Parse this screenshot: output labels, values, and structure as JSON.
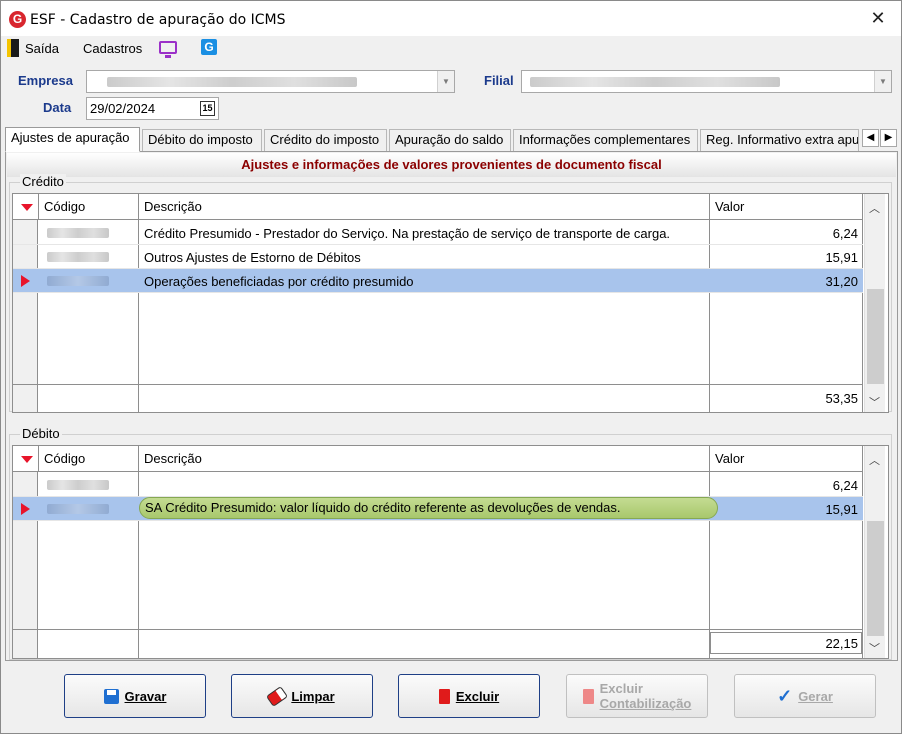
{
  "window": {
    "title": "ESF - Cadastro de apuração do ICMS",
    "app_icon_letter": "G",
    "close_glyph": "✕"
  },
  "menu": {
    "items": [
      {
        "label": "Saída",
        "icon": "exit-door-icon"
      },
      {
        "label": "Cadastros",
        "icon": "monitor-icon"
      }
    ],
    "extra_icon": {
      "name": "g-app-icon",
      "letter": "G"
    }
  },
  "filters": {
    "empresa_label": "Empresa",
    "filial_label": "Filial",
    "data_label": "Data",
    "data_value": "29/02/2024",
    "calendar_glyph": "15"
  },
  "tabs": [
    {
      "label": "Ajustes de apuração",
      "active": true
    },
    {
      "label": "Débito do imposto",
      "active": false
    },
    {
      "label": "Crédito do imposto",
      "active": false
    },
    {
      "label": "Apuração do saldo",
      "active": false
    },
    {
      "label": "Informações complementares",
      "active": false
    },
    {
      "label": "Reg. Informativo extra apu",
      "active": false
    }
  ],
  "panel": {
    "header": "Ajustes e informações de valores provenientes de documento fiscal",
    "credito": {
      "legend": "Crédito",
      "columns": [
        "Código",
        "Descrição",
        "Valor"
      ],
      "rows": [
        {
          "descricao": "Crédito Presumido - Prestador do Serviço. Na prestação de serviço de transporte de carga.",
          "valor": "6,24"
        },
        {
          "descricao": "Outros Ajustes de Estorno de Débitos",
          "valor": "15,91"
        },
        {
          "descricao": "Operações beneficiadas por crédito presumido",
          "valor": "31,20"
        }
      ],
      "total": "53,35"
    },
    "debito": {
      "legend": "Débito",
      "columns": [
        "Código",
        "Descrição",
        "Valor"
      ],
      "rows": [
        {
          "descricao": "",
          "valor": "6,24"
        },
        {
          "descricao": "",
          "valor": "15,91"
        }
      ],
      "hint": "SA Crédito Presumido: valor líquido do crédito referente as devoluções de vendas.",
      "total": "22,15"
    }
  },
  "buttons": [
    {
      "label": "Gravar",
      "mnemonic": "G",
      "enabled": true
    },
    {
      "label": "Limpar",
      "mnemonic": "L",
      "enabled": true
    },
    {
      "label": "Excluir",
      "mnemonic": "E",
      "enabled": true
    },
    {
      "label_line1": "Excluir",
      "label_line2": "Contabilização",
      "enabled": false
    },
    {
      "label": "Gerar",
      "mnemonic": "G",
      "enabled": false
    }
  ],
  "colors": {
    "accent_red": "#e8142a",
    "label_blue": "#1b3a8c",
    "header_red": "#8b0000",
    "selection": "#a8c4ec"
  }
}
